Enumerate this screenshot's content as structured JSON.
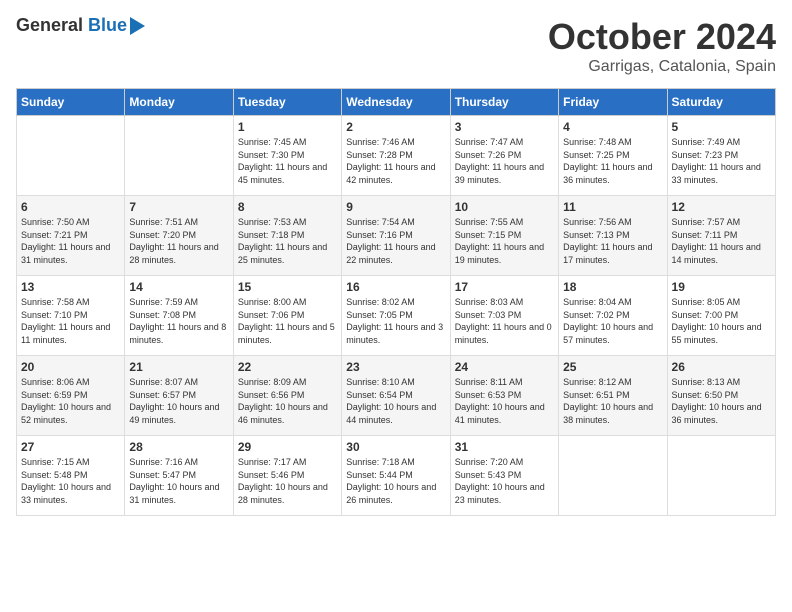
{
  "header": {
    "logo_line1": "General",
    "logo_line2": "Blue",
    "month": "October 2024",
    "location": "Garrigas, Catalonia, Spain"
  },
  "days_of_week": [
    "Sunday",
    "Monday",
    "Tuesday",
    "Wednesday",
    "Thursday",
    "Friday",
    "Saturday"
  ],
  "weeks": [
    [
      {
        "num": "",
        "detail": ""
      },
      {
        "num": "",
        "detail": ""
      },
      {
        "num": "1",
        "detail": "Sunrise: 7:45 AM\nSunset: 7:30 PM\nDaylight: 11 hours and 45 minutes."
      },
      {
        "num": "2",
        "detail": "Sunrise: 7:46 AM\nSunset: 7:28 PM\nDaylight: 11 hours and 42 minutes."
      },
      {
        "num": "3",
        "detail": "Sunrise: 7:47 AM\nSunset: 7:26 PM\nDaylight: 11 hours and 39 minutes."
      },
      {
        "num": "4",
        "detail": "Sunrise: 7:48 AM\nSunset: 7:25 PM\nDaylight: 11 hours and 36 minutes."
      },
      {
        "num": "5",
        "detail": "Sunrise: 7:49 AM\nSunset: 7:23 PM\nDaylight: 11 hours and 33 minutes."
      }
    ],
    [
      {
        "num": "6",
        "detail": "Sunrise: 7:50 AM\nSunset: 7:21 PM\nDaylight: 11 hours and 31 minutes."
      },
      {
        "num": "7",
        "detail": "Sunrise: 7:51 AM\nSunset: 7:20 PM\nDaylight: 11 hours and 28 minutes."
      },
      {
        "num": "8",
        "detail": "Sunrise: 7:53 AM\nSunset: 7:18 PM\nDaylight: 11 hours and 25 minutes."
      },
      {
        "num": "9",
        "detail": "Sunrise: 7:54 AM\nSunset: 7:16 PM\nDaylight: 11 hours and 22 minutes."
      },
      {
        "num": "10",
        "detail": "Sunrise: 7:55 AM\nSunset: 7:15 PM\nDaylight: 11 hours and 19 minutes."
      },
      {
        "num": "11",
        "detail": "Sunrise: 7:56 AM\nSunset: 7:13 PM\nDaylight: 11 hours and 17 minutes."
      },
      {
        "num": "12",
        "detail": "Sunrise: 7:57 AM\nSunset: 7:11 PM\nDaylight: 11 hours and 14 minutes."
      }
    ],
    [
      {
        "num": "13",
        "detail": "Sunrise: 7:58 AM\nSunset: 7:10 PM\nDaylight: 11 hours and 11 minutes."
      },
      {
        "num": "14",
        "detail": "Sunrise: 7:59 AM\nSunset: 7:08 PM\nDaylight: 11 hours and 8 minutes."
      },
      {
        "num": "15",
        "detail": "Sunrise: 8:00 AM\nSunset: 7:06 PM\nDaylight: 11 hours and 5 minutes."
      },
      {
        "num": "16",
        "detail": "Sunrise: 8:02 AM\nSunset: 7:05 PM\nDaylight: 11 hours and 3 minutes."
      },
      {
        "num": "17",
        "detail": "Sunrise: 8:03 AM\nSunset: 7:03 PM\nDaylight: 11 hours and 0 minutes."
      },
      {
        "num": "18",
        "detail": "Sunrise: 8:04 AM\nSunset: 7:02 PM\nDaylight: 10 hours and 57 minutes."
      },
      {
        "num": "19",
        "detail": "Sunrise: 8:05 AM\nSunset: 7:00 PM\nDaylight: 10 hours and 55 minutes."
      }
    ],
    [
      {
        "num": "20",
        "detail": "Sunrise: 8:06 AM\nSunset: 6:59 PM\nDaylight: 10 hours and 52 minutes."
      },
      {
        "num": "21",
        "detail": "Sunrise: 8:07 AM\nSunset: 6:57 PM\nDaylight: 10 hours and 49 minutes."
      },
      {
        "num": "22",
        "detail": "Sunrise: 8:09 AM\nSunset: 6:56 PM\nDaylight: 10 hours and 46 minutes."
      },
      {
        "num": "23",
        "detail": "Sunrise: 8:10 AM\nSunset: 6:54 PM\nDaylight: 10 hours and 44 minutes."
      },
      {
        "num": "24",
        "detail": "Sunrise: 8:11 AM\nSunset: 6:53 PM\nDaylight: 10 hours and 41 minutes."
      },
      {
        "num": "25",
        "detail": "Sunrise: 8:12 AM\nSunset: 6:51 PM\nDaylight: 10 hours and 38 minutes."
      },
      {
        "num": "26",
        "detail": "Sunrise: 8:13 AM\nSunset: 6:50 PM\nDaylight: 10 hours and 36 minutes."
      }
    ],
    [
      {
        "num": "27",
        "detail": "Sunrise: 7:15 AM\nSunset: 5:48 PM\nDaylight: 10 hours and 33 minutes."
      },
      {
        "num": "28",
        "detail": "Sunrise: 7:16 AM\nSunset: 5:47 PM\nDaylight: 10 hours and 31 minutes."
      },
      {
        "num": "29",
        "detail": "Sunrise: 7:17 AM\nSunset: 5:46 PM\nDaylight: 10 hours and 28 minutes."
      },
      {
        "num": "30",
        "detail": "Sunrise: 7:18 AM\nSunset: 5:44 PM\nDaylight: 10 hours and 26 minutes."
      },
      {
        "num": "31",
        "detail": "Sunrise: 7:20 AM\nSunset: 5:43 PM\nDaylight: 10 hours and 23 minutes."
      },
      {
        "num": "",
        "detail": ""
      },
      {
        "num": "",
        "detail": ""
      }
    ]
  ]
}
